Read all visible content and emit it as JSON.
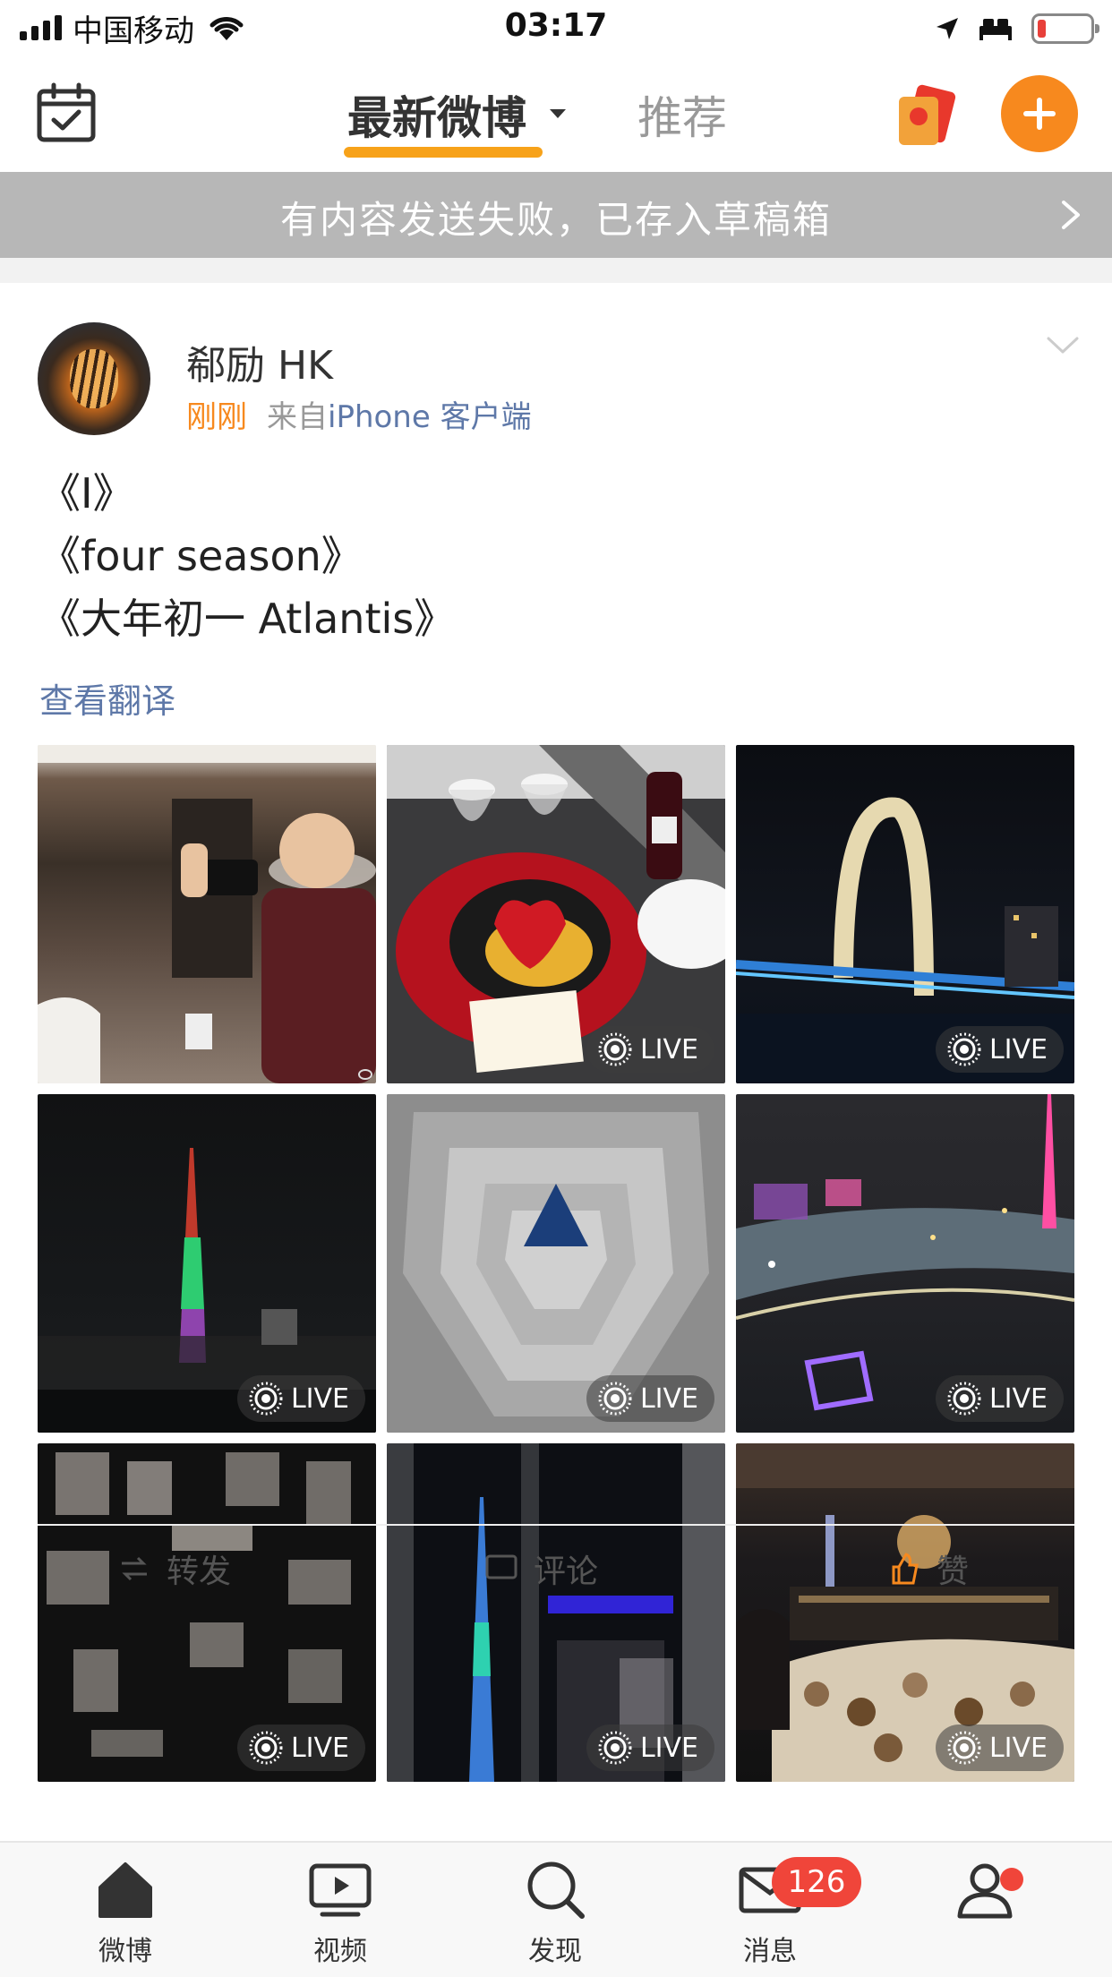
{
  "status_bar": {
    "carrier": "中国移动",
    "time": "03:17"
  },
  "nav": {
    "active_tab": "最新微博",
    "other_tab": "推荐"
  },
  "banner": {
    "text": "有内容发送失败，已存入草稿箱"
  },
  "post": {
    "username": "郗励 HK",
    "time": "刚刚",
    "source_prefix": "来自",
    "source_client": "iPhone 客户端",
    "lines": [
      "《I》",
      "《four season》",
      "《大年初一 Atlantis》"
    ],
    "translate_link": "查看翻译",
    "photos": [
      {
        "name": "selfie-mirror",
        "live": false
      },
      {
        "name": "anniversary-dessert",
        "live": true
      },
      {
        "name": "liede-bridge-night",
        "live": true
      },
      {
        "name": "canton-tower-night",
        "live": true
      },
      {
        "name": "atrium-spiral",
        "live": true
      },
      {
        "name": "pearl-river-aerial",
        "live": true
      },
      {
        "name": "lit-wall-panels",
        "live": true
      },
      {
        "name": "canton-tower-window",
        "live": true
      },
      {
        "name": "agate-bar",
        "live": true
      }
    ],
    "live_label": "LIVE",
    "actions": {
      "repost": "转发",
      "comment": "评论",
      "like": "赞"
    }
  },
  "tabbar": {
    "items": [
      "微博",
      "视频",
      "发现",
      "消息",
      ""
    ],
    "message_badge": "126"
  },
  "colors": {
    "accent": "#f7891e",
    "link": "#5e78a8",
    "badge": "#f0453a"
  }
}
